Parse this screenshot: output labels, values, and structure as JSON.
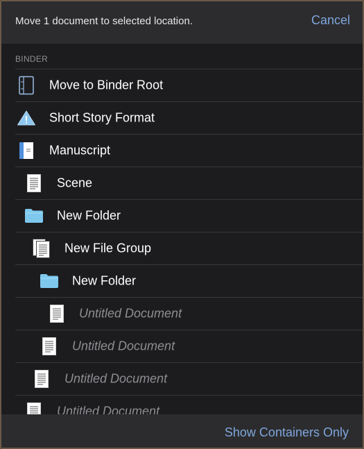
{
  "header": {
    "title": "Move 1 document to selected location.",
    "cancel_label": "Cancel"
  },
  "section_label": "BINDER",
  "rows": [
    {
      "label": "Move to Binder Root",
      "icon": "binder-icon",
      "dim": false
    },
    {
      "label": "Short Story Format",
      "icon": "warning-triangle-icon",
      "dim": false
    },
    {
      "label": "Manuscript",
      "icon": "manuscript-icon",
      "dim": false
    },
    {
      "label": "Scene",
      "icon": "document-icon",
      "dim": false
    },
    {
      "label": "New Folder",
      "icon": "folder-icon",
      "dim": false
    },
    {
      "label": "New File Group",
      "icon": "file-group-icon",
      "dim": false
    },
    {
      "label": "New Folder",
      "icon": "folder-icon",
      "dim": false
    },
    {
      "label": "Untitled Document",
      "icon": "document-icon",
      "dim": true
    },
    {
      "label": "Untitled Document",
      "icon": "document-icon",
      "dim": true
    },
    {
      "label": "Untitled Document",
      "icon": "document-icon",
      "dim": true
    },
    {
      "label": "Untitled Document",
      "icon": "document-icon",
      "dim": true
    }
  ],
  "footer": {
    "show_containers_label": "Show Containers Only"
  },
  "colors": {
    "accent": "#7fa6dc",
    "folder": "#7ec8ee",
    "background": "#1c1c1e"
  }
}
